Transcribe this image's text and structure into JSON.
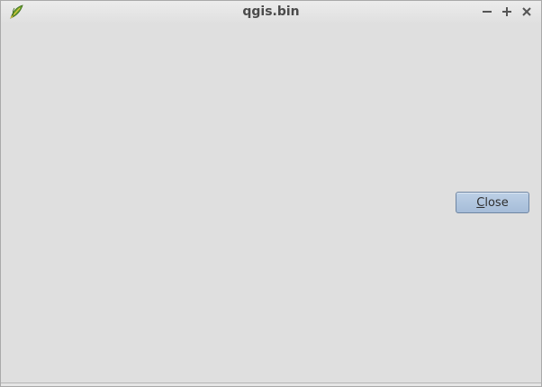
{
  "window": {
    "title": "qgis.bin",
    "app_icon": "qgis-leaf-icon"
  },
  "title_controls": {
    "minimize_icon": "minimize-icon",
    "maximize_icon": "maximize-icon",
    "close_icon": "close-icon"
  },
  "dialog": {
    "close_button": {
      "label_mnemonic": "C",
      "label_rest": "lose"
    }
  },
  "colors": {
    "background": "#dfdfdf",
    "button_fill": "#b3c8e0",
    "button_border": "#6f86a3",
    "title_text": "#4b4b4b",
    "icon_green": "#6aa42e"
  }
}
